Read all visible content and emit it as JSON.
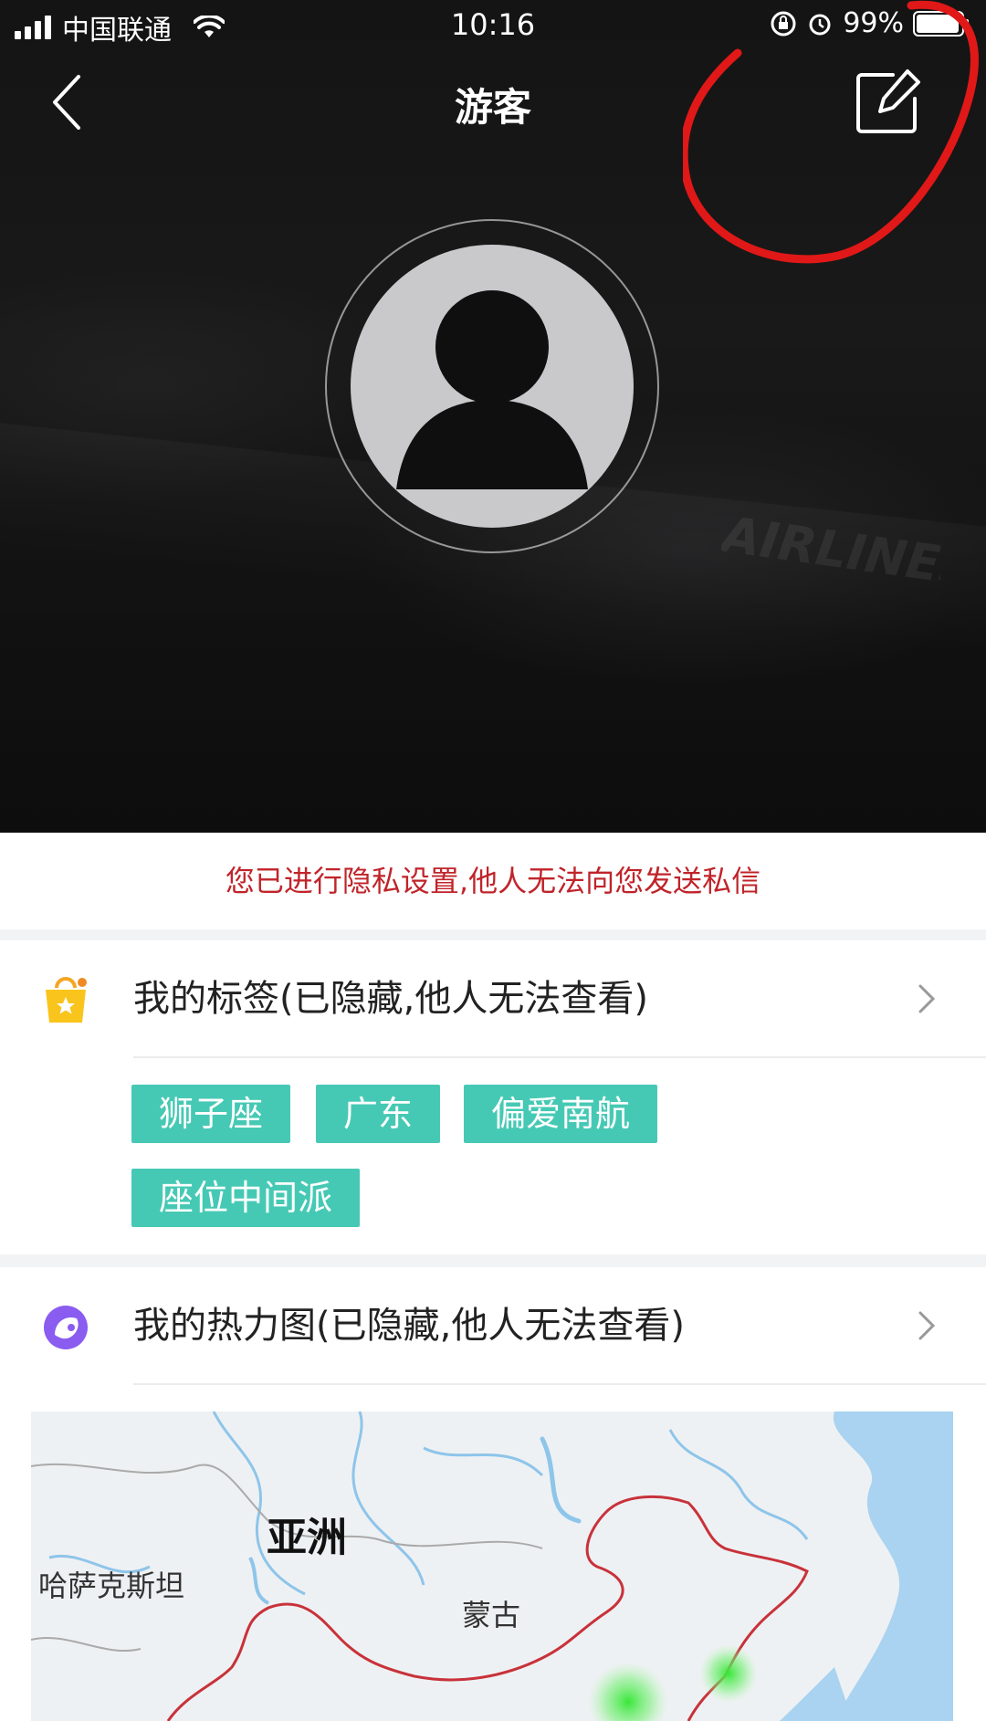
{
  "status_bar": {
    "carrier": "中国联通",
    "time": "10:16",
    "battery": "99%",
    "battery_level": 0.99
  },
  "nav": {
    "title": "游客"
  },
  "privacy_notice": "您已进行隐私设置,他人无法向您发送私信",
  "tags_section": {
    "label": "我的标签(已隐藏,他人无法查看)",
    "tags": [
      "狮子座",
      "广东",
      "偏爱南航",
      "座位中间派"
    ]
  },
  "heatmap_section": {
    "label": "我的热力图(已隐藏,他人无法查看)",
    "map_labels": {
      "continent": "亚洲",
      "kazakhstan": "哈萨克斯坦",
      "mongolia": "蒙古"
    }
  },
  "background_text": "AIRLINES",
  "colors": {
    "accent_tag": "#46c9b4",
    "notice_red": "#c0242a",
    "annotation_red": "#e01818",
    "border_red": "#c8323a",
    "heat_green": "#39e639"
  },
  "icons": {
    "back": "chevron-left-icon",
    "edit": "edit-icon",
    "tags": "shopping-bag-star-icon",
    "heatmap": "heatmap-icon",
    "chevron": "chevron-right-icon"
  }
}
